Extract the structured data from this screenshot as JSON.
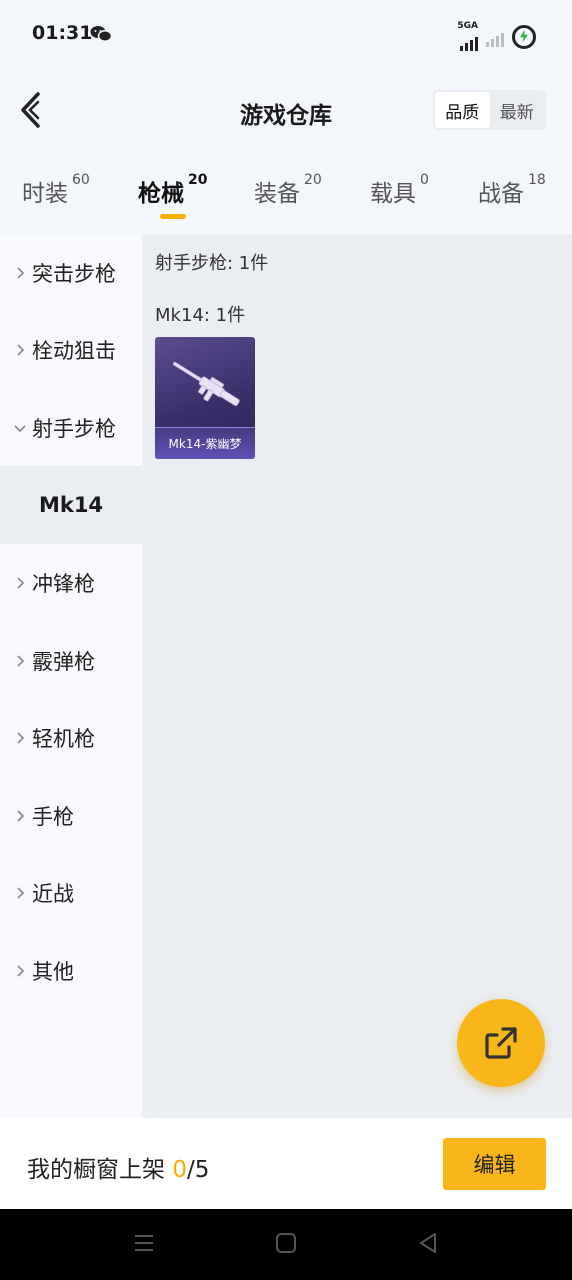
{
  "status_bar": {
    "time": "01:31",
    "network_label": "5GA"
  },
  "header": {
    "title": "游戏仓库",
    "sort_options": [
      "品质",
      "最新"
    ],
    "active_sort": "品质"
  },
  "tabs": [
    {
      "label": "时装",
      "count": "60"
    },
    {
      "label": "枪械",
      "count": "20"
    },
    {
      "label": "装备",
      "count": "20"
    },
    {
      "label": "载具",
      "count": "0"
    },
    {
      "label": "战备",
      "count": "18"
    }
  ],
  "active_tab": "枪械",
  "sidebar": {
    "items": [
      {
        "label": "突击步枪",
        "expanded": false
      },
      {
        "label": "栓动狙击",
        "expanded": false
      },
      {
        "label": "射手步枪",
        "expanded": true
      },
      {
        "label": "冲锋枪",
        "expanded": false
      },
      {
        "label": "霰弹枪",
        "expanded": false
      },
      {
        "label": "轻机枪",
        "expanded": false
      },
      {
        "label": "手枪",
        "expanded": false
      },
      {
        "label": "近战",
        "expanded": false
      },
      {
        "label": "其他",
        "expanded": false
      }
    ],
    "selected_sub": "Mk14"
  },
  "content": {
    "group_label": "射手步枪: 1件",
    "sub_group_label": "Mk14: 1件",
    "items": [
      {
        "name": "Mk14-紫幽梦"
      }
    ]
  },
  "bottom_bar": {
    "prefix": "我的橱窗上架 ",
    "current": "0",
    "total": "/5",
    "edit_label": "编辑"
  },
  "colors": {
    "accent": "#f8b61b",
    "active_indicator": "#f5b000",
    "card_bg": "#3b2f6b"
  }
}
